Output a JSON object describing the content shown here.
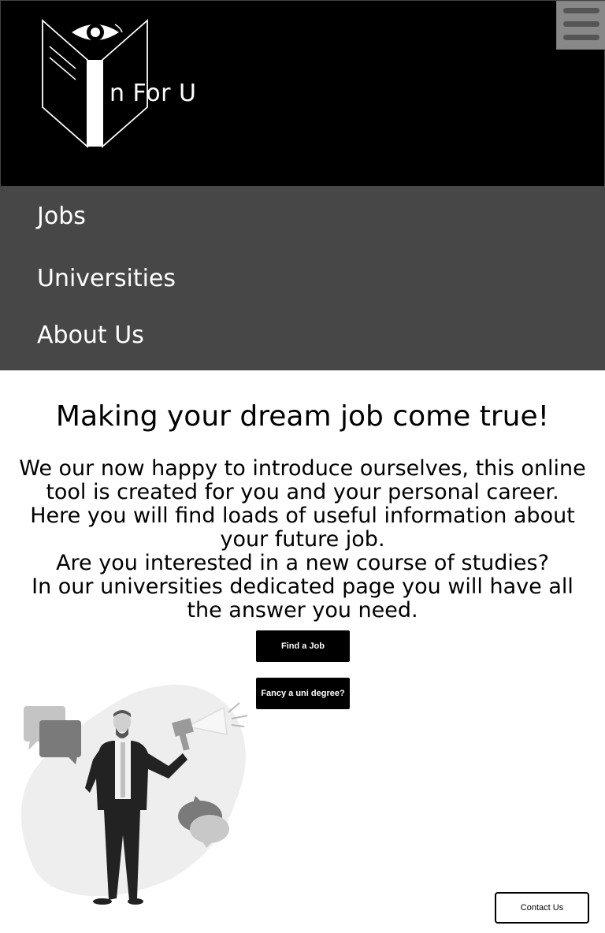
{
  "header": {
    "logo_text": "n For U",
    "menu_icon": "hamburger-icon"
  },
  "nav": {
    "items": [
      {
        "label": "Jobs"
      },
      {
        "label": "Universities"
      },
      {
        "label": "About Us"
      }
    ]
  },
  "main": {
    "headline": "Making your dream job come true!",
    "intro_lines": [
      "We our now happy to introduce ourselves, this online tool is created for you and your personal career.",
      "Here you will find loads of useful information about your future job.",
      "Are you interested in a new course of studies?",
      "In our universities dedicated page you will have all the answer you need."
    ],
    "find_job_label": "Find a Job",
    "uni_degree_label": "Fancy a uni degree?"
  },
  "footer": {
    "contact_label": "Contact Us"
  },
  "colors": {
    "header_bg": "#000000",
    "nav_bg": "#474747",
    "button_bg": "#000000",
    "menu_button_bg": "#888888"
  }
}
